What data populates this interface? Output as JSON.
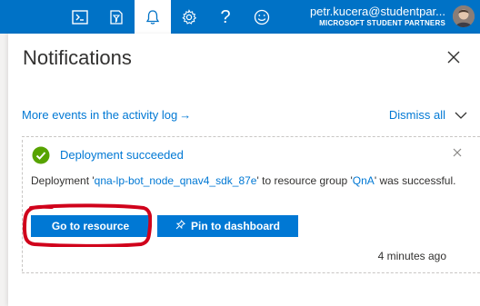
{
  "topbar": {
    "background": "#0072c6",
    "icons": [
      "cloud-shell-icon",
      "directory-filter-icon",
      "notifications-bell-icon",
      "settings-gear-icon",
      "help-icon",
      "feedback-smiley-icon"
    ],
    "help_glyph": "?",
    "account": {
      "email": "petr.kucera@studentpar...",
      "organization": "MICROSOFT STUDENT PARTNERS"
    }
  },
  "panel": {
    "title": "Notifications",
    "activity_link": "More events in the activity log",
    "activity_arrow": "→",
    "dismiss_label": "Dismiss all"
  },
  "notification": {
    "status_color": "#57a300",
    "title": "Deployment succeeded",
    "message": {
      "prefix": "Deployment '",
      "deployment_name": "qna-lp-bot_node_qnav4_sdk_87e",
      "middle": "' to resource group '",
      "resource_group": "QnA",
      "suffix": "' was successful."
    },
    "primary_button": "Go to resource",
    "secondary_button": "Pin to dashboard",
    "time": "4 minutes ago"
  },
  "annotation_color": "#d0021b",
  "accent_color": "#0078d4"
}
